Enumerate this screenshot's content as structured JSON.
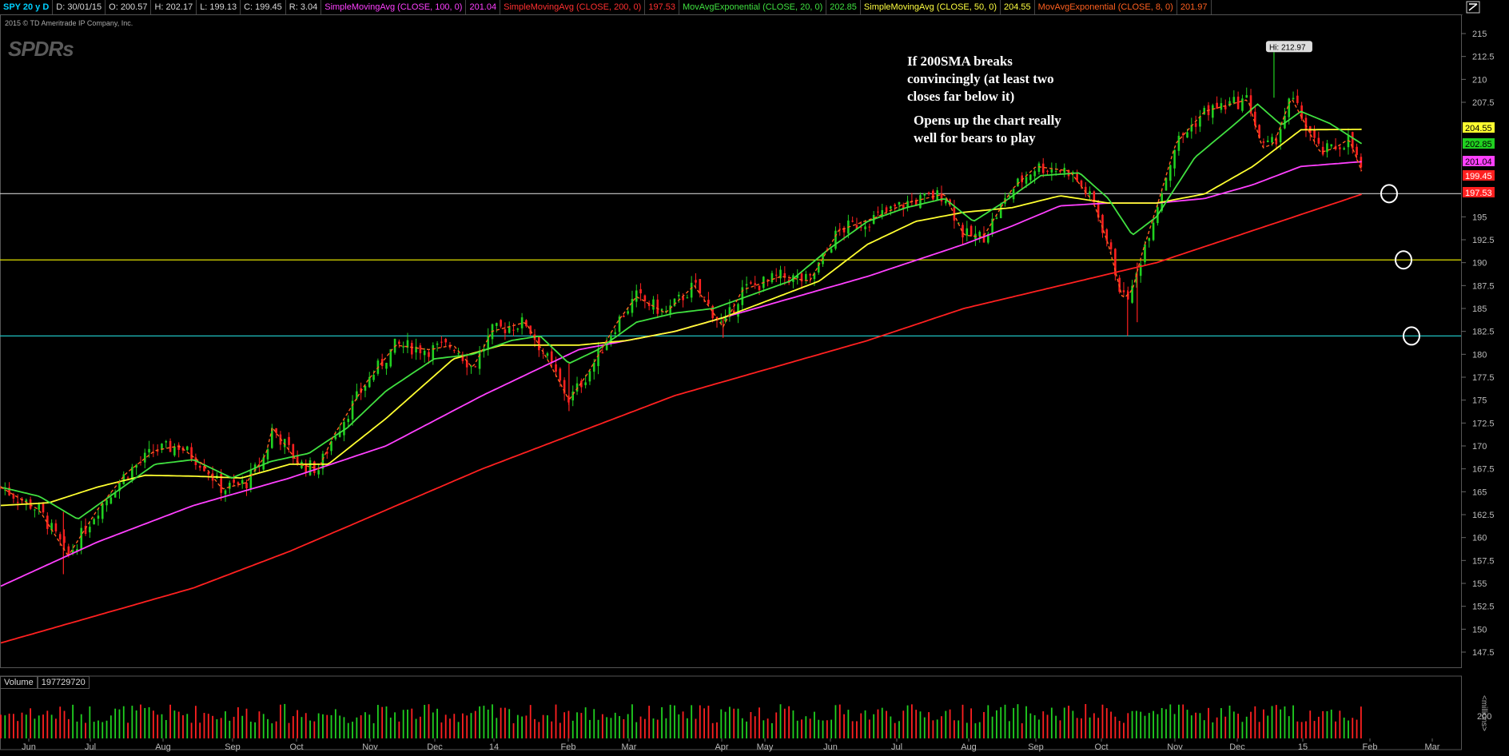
{
  "toolbar": {
    "symbol": "SPY 20 y D",
    "date": "D: 30/01/15",
    "open": "O: 200.57",
    "high": "H: 202.17",
    "low": "L: 199.13",
    "close": "C: 199.45",
    "range": "R: 3.04",
    "studies": [
      {
        "label": "SimpleMovingAvg (CLOSE, 100, 0)",
        "value": "201.04",
        "color": "#ff40ff"
      },
      {
        "label": "SimpleMovingAvg (CLOSE, 200, 0)",
        "value": "197.53",
        "color": "#ff3030"
      },
      {
        "label": "MovAvgExponential (CLOSE, 20, 0)",
        "value": "202.85",
        "color": "#40e040"
      },
      {
        "label": "SimpleMovingAvg (CLOSE, 50, 0)",
        "value": "204.55",
        "color": "#ffff40"
      },
      {
        "label": "MovAvgExponential (CLOSE, 8, 0)",
        "value": "201.97",
        "color": "#ff6020"
      }
    ]
  },
  "copyright": "2015 © TD Ameritrade IP Company, Inc.",
  "logo": "SPDRs",
  "annotations": {
    "note1": "If 200SMA breaks\nconvincingly (at least two\ncloses far below it)",
    "note2": "Opens up the chart really\nwell for bears to play"
  },
  "volume_panel": {
    "title": "Volume",
    "value": "197729720",
    "axis_tick": "200",
    "unit_label": "<millions>"
  },
  "colors": {
    "up": "#20d020",
    "down": "#ff2020",
    "sma100": "#ff40ff",
    "sma200": "#ff2020",
    "ema20": "#40e040",
    "sma50": "#ffff30",
    "ema8": "#ff6020"
  },
  "chart_data": {
    "type": "candlestick",
    "title": "SPY 20 y D",
    "ylim": [
      145.5,
      216.5
    ],
    "yticks": [
      "147.5",
      "150",
      "152.5",
      "155",
      "157.5",
      "160",
      "162.5",
      "165",
      "167.5",
      "170",
      "172.5",
      "175",
      "177.5",
      "180",
      "182.5",
      "185",
      "187.5",
      "190",
      "192.5",
      "195",
      "207.5",
      "210",
      "212.5",
      "215"
    ],
    "months": [
      "Jun",
      "Jul",
      "Aug",
      "Sep",
      "Oct",
      "Nov",
      "Dec",
      "14",
      "Feb",
      "Mar",
      "Apr",
      "May",
      "Jun",
      "Jul",
      "Aug",
      "Sep",
      "Oct",
      "Nov",
      "Dec",
      "15",
      "Feb",
      "Mar"
    ],
    "price_keys": [
      [
        0,
        165.5
      ],
      [
        40,
        163
      ],
      [
        70,
        158
      ],
      [
        100,
        163
      ],
      [
        130,
        167
      ],
      [
        160,
        169.5
      ],
      [
        185,
        170
      ],
      [
        210,
        168
      ],
      [
        230,
        165.3
      ],
      [
        255,
        166
      ],
      [
        275,
        169
      ],
      [
        282,
        172
      ],
      [
        310,
        168
      ],
      [
        330,
        167.5
      ],
      [
        345,
        171
      ],
      [
        380,
        177
      ],
      [
        410,
        181
      ],
      [
        445,
        180.5
      ],
      [
        470,
        181
      ],
      [
        490,
        178.5
      ],
      [
        510,
        182.5
      ],
      [
        545,
        183.5
      ],
      [
        570,
        179
      ],
      [
        590,
        175
      ],
      [
        610,
        178
      ],
      [
        640,
        183.5
      ],
      [
        660,
        186.3
      ],
      [
        690,
        184.5
      ],
      [
        720,
        187.5
      ],
      [
        750,
        183
      ],
      [
        770,
        187
      ],
      [
        810,
        188.5
      ],
      [
        840,
        188
      ],
      [
        870,
        193.5
      ],
      [
        910,
        195
      ],
      [
        940,
        196.5
      ],
      [
        980,
        197.5
      ],
      [
        1000,
        193
      ],
      [
        1020,
        192.8
      ],
      [
        1050,
        198
      ],
      [
        1075,
        200.5
      ],
      [
        1110,
        200
      ],
      [
        1135,
        196.5
      ],
      [
        1150,
        192
      ],
      [
        1165,
        186
      ],
      [
        1175,
        187
      ],
      [
        1185,
        191
      ],
      [
        1200,
        196
      ],
      [
        1220,
        203
      ],
      [
        1250,
        206.5
      ],
      [
        1295,
        207.8
      ],
      [
        1310,
        202.5
      ],
      [
        1322,
        203
      ],
      [
        1340,
        208
      ],
      [
        1355,
        205
      ],
      [
        1370,
        202
      ],
      [
        1385,
        202.5
      ],
      [
        1400,
        203.5
      ],
      [
        1415,
        199.45
      ]
    ],
    "sma50_keys": [
      [
        0,
        163.5
      ],
      [
        50,
        163.8
      ],
      [
        100,
        165.5
      ],
      [
        150,
        166.8
      ],
      [
        200,
        166.7
      ],
      [
        250,
        166.5
      ],
      [
        300,
        168
      ],
      [
        340,
        168
      ],
      [
        400,
        173
      ],
      [
        470,
        179.5
      ],
      [
        520,
        181
      ],
      [
        560,
        181
      ],
      [
        600,
        181
      ],
      [
        650,
        181.5
      ],
      [
        700,
        182.5
      ],
      [
        750,
        184
      ],
      [
        800,
        186
      ],
      [
        850,
        188
      ],
      [
        900,
        192
      ],
      [
        950,
        194.5
      ],
      [
        1000,
        195.5
      ],
      [
        1050,
        196
      ],
      [
        1100,
        197.3
      ],
      [
        1150,
        196.5
      ],
      [
        1200,
        196.5
      ],
      [
        1250,
        197.5
      ],
      [
        1300,
        200.5
      ],
      [
        1350,
        204.5
      ],
      [
        1415,
        204.55
      ]
    ],
    "sma100_keys": [
      [
        0,
        154.7
      ],
      [
        100,
        159.5
      ],
      [
        200,
        163.5
      ],
      [
        300,
        166.5
      ],
      [
        400,
        170
      ],
      [
        500,
        175.5
      ],
      [
        600,
        180.5
      ],
      [
        700,
        182.5
      ],
      [
        800,
        185.5
      ],
      [
        900,
        188.5
      ],
      [
        1000,
        192
      ],
      [
        1050,
        194
      ],
      [
        1100,
        196.2
      ],
      [
        1150,
        196.5
      ],
      [
        1200,
        196.5
      ],
      [
        1250,
        197
      ],
      [
        1300,
        198.5
      ],
      [
        1350,
        200.5
      ],
      [
        1415,
        201.04
      ]
    ],
    "sma200_keys": [
      [
        0,
        148.5
      ],
      [
        100,
        151.5
      ],
      [
        200,
        154.5
      ],
      [
        300,
        158.5
      ],
      [
        400,
        163
      ],
      [
        500,
        167.5
      ],
      [
        600,
        171.5
      ],
      [
        700,
        175.5
      ],
      [
        800,
        178.5
      ],
      [
        900,
        181.5
      ],
      [
        1000,
        185
      ],
      [
        1100,
        187.5
      ],
      [
        1200,
        190
      ],
      [
        1300,
        193.5
      ],
      [
        1415,
        197.53
      ]
    ],
    "ema20_keys": [
      [
        0,
        165.5
      ],
      [
        40,
        164.5
      ],
      [
        80,
        162
      ],
      [
        120,
        165
      ],
      [
        160,
        168
      ],
      [
        200,
        168.5
      ],
      [
        240,
        166.5
      ],
      [
        280,
        168.3
      ],
      [
        320,
        169.2
      ],
      [
        360,
        172
      ],
      [
        400,
        176
      ],
      [
        450,
        179.5
      ],
      [
        490,
        180
      ],
      [
        530,
        181.5
      ],
      [
        560,
        182
      ],
      [
        590,
        179
      ],
      [
        620,
        180.5
      ],
      [
        660,
        183.5
      ],
      [
        700,
        184.5
      ],
      [
        740,
        185
      ],
      [
        780,
        186.5
      ],
      [
        820,
        188
      ],
      [
        860,
        191.5
      ],
      [
        900,
        194.5
      ],
      [
        940,
        196
      ],
      [
        980,
        197
      ],
      [
        1010,
        194.5
      ],
      [
        1040,
        196.5
      ],
      [
        1080,
        199.5
      ],
      [
        1120,
        199.8
      ],
      [
        1150,
        197
      ],
      [
        1175,
        193
      ],
      [
        1200,
        195
      ],
      [
        1240,
        201.5
      ],
      [
        1280,
        205
      ],
      [
        1305,
        207.3
      ],
      [
        1330,
        205
      ],
      [
        1350,
        206.5
      ],
      [
        1380,
        205.2
      ],
      [
        1415,
        202.85
      ]
    ],
    "hlines": [
      {
        "value": 197.53,
        "color": "#cccccc"
      },
      {
        "value": 190.3,
        "color": "#e0e000"
      },
      {
        "value": 182.0,
        "color": "#20c0c0"
      }
    ],
    "circles": [
      197.53,
      190.3,
      182.0
    ],
    "price_tags": [
      {
        "value": "204.55",
        "bg": "#ffff30",
        "fg": "#000"
      },
      {
        "value": "202.85",
        "bg": "#20d020",
        "fg": "#000"
      },
      {
        "value": "201.04",
        "bg": "#ff40ff",
        "fg": "#000"
      },
      {
        "value": "199.45",
        "bg": "#ff2020",
        "fg": "#fff"
      },
      {
        "value": "197.53",
        "bg": "#ff2020",
        "fg": "#fff"
      }
    ],
    "high_label": "Hi: 212.97",
    "high_value": 212.97
  }
}
